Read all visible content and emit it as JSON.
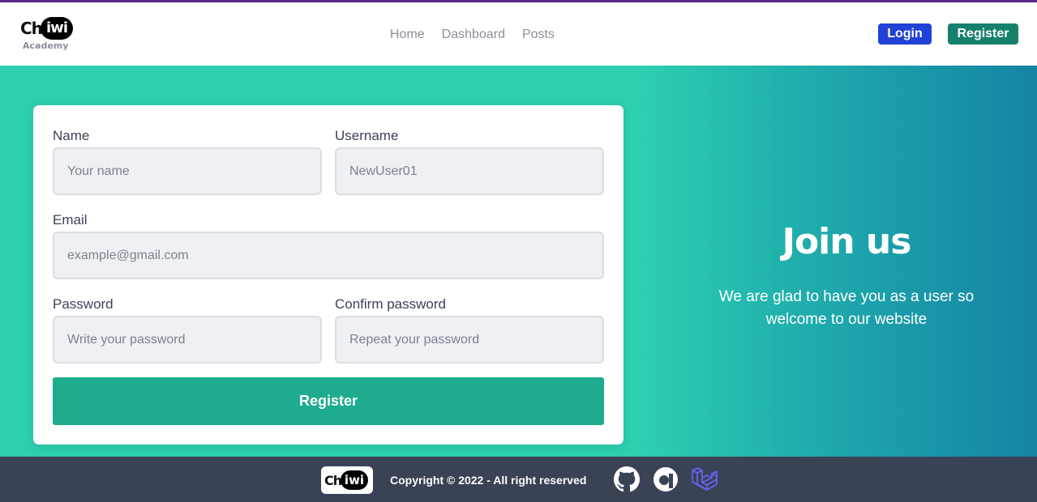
{
  "navbar": {
    "logo": {
      "main_prefix": "Ch",
      "main_bubble": "iwi",
      "subtitle": "Academy"
    },
    "menu": [
      {
        "label": "Home"
      },
      {
        "label": "Dashboard"
      },
      {
        "label": "Posts"
      }
    ],
    "login_label": "Login",
    "register_label": "Register"
  },
  "form": {
    "name": {
      "label": "Name",
      "placeholder": "Your name"
    },
    "username": {
      "label": "Username",
      "placeholder": "NewUser01"
    },
    "email": {
      "label": "Email",
      "placeholder": "example@gmail.com"
    },
    "password": {
      "label": "Password",
      "placeholder": "Write your password"
    },
    "confirm_password": {
      "label": "Confirm password",
      "placeholder": "Repeat your password"
    },
    "submit_label": "Register"
  },
  "hero": {
    "title": "Join us",
    "text": "We are glad to have you as a user so welcome to our website"
  },
  "footer": {
    "logo": {
      "main_prefix": "Ch",
      "main_bubble": "iwi"
    },
    "copyright": "Copyright © 2022 - All right reserved",
    "icons": [
      "github-icon",
      "alpine-a-icon",
      "laravel-icon"
    ]
  },
  "colors": {
    "accent_top_line": "#5b2a86",
    "login_button": "#2142d6",
    "register_button": "#15806c",
    "hero_gradient_start": "#2dcfb0",
    "hero_gradient_end": "#1484a3",
    "submit_button": "#1eab8e",
    "footer_bg": "#3a4256"
  }
}
